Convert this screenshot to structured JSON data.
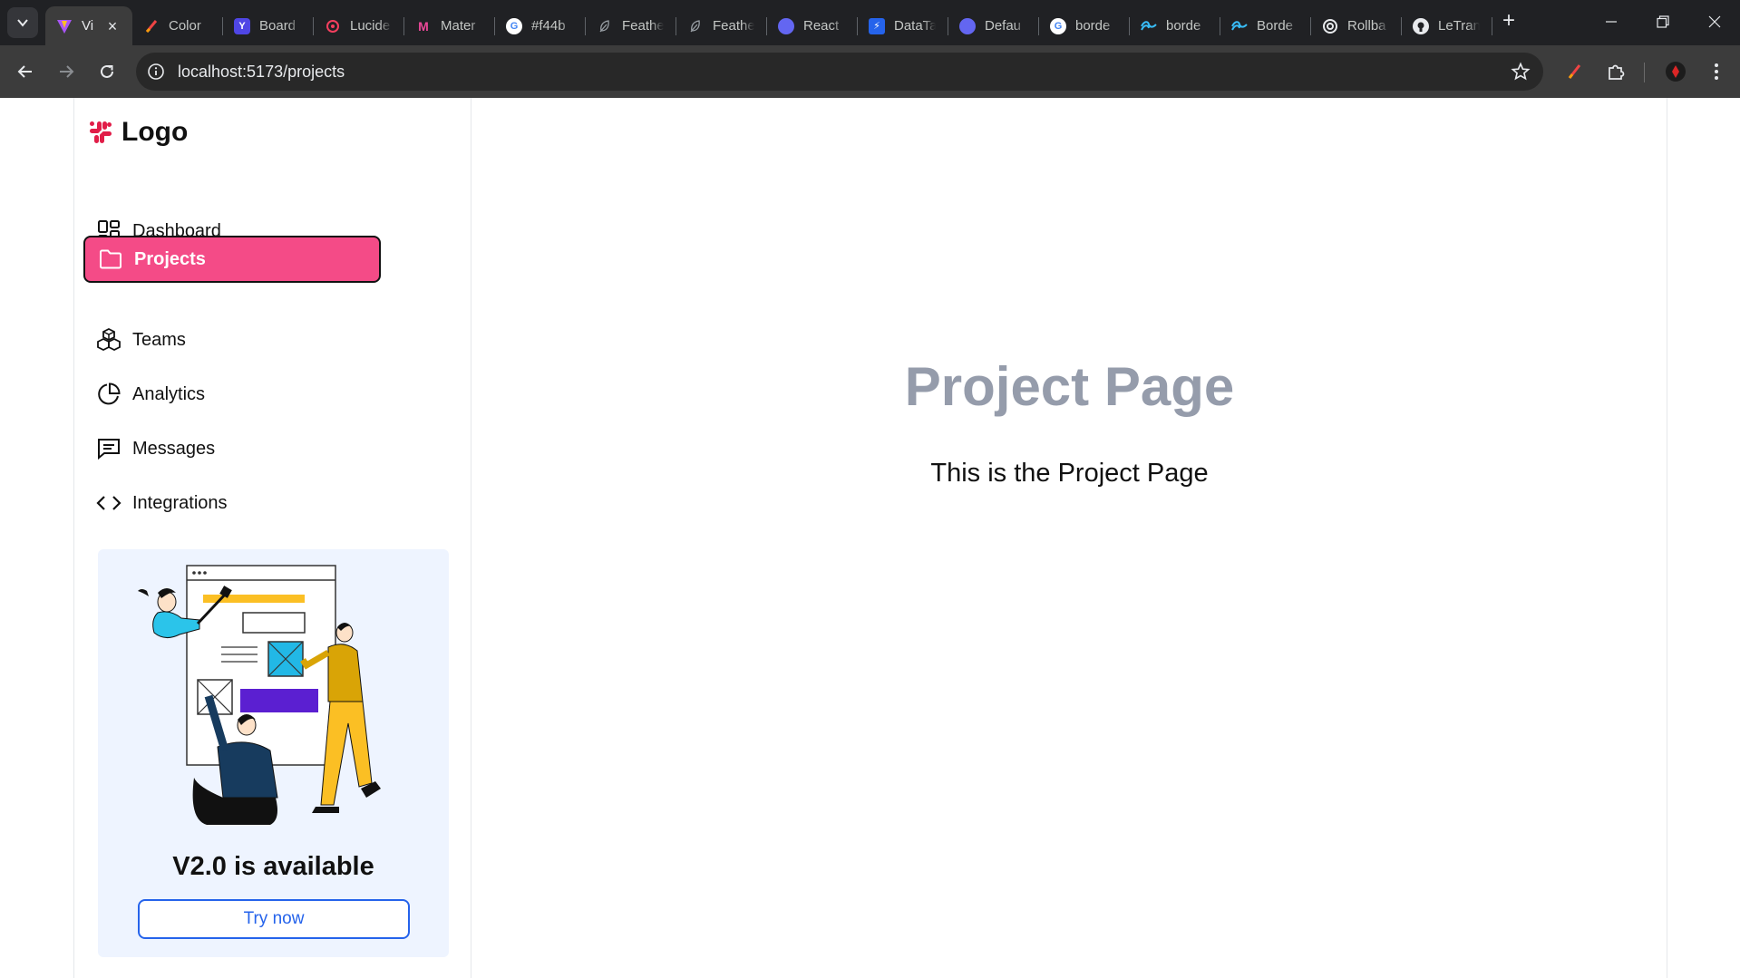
{
  "browser": {
    "tabs": [
      {
        "title": "Vi",
        "active": true,
        "favicon": "vite-icon",
        "color": "#a855f7"
      },
      {
        "title": "Color",
        "favicon": "brush-icon",
        "color": "#ef4444"
      },
      {
        "title": "Board",
        "favicon": "y-icon",
        "color": "#6366f1"
      },
      {
        "title": "Lucide",
        "favicon": "lucide-icon",
        "color": "#f43f5e"
      },
      {
        "title": "Mater",
        "favicon": "material-icon",
        "color": "#ec4899"
      },
      {
        "title": "#f44b",
        "favicon": "google-icon",
        "color": "#ffffff"
      },
      {
        "title": "Feathe",
        "favicon": "feather-icon",
        "color": "#5f6368"
      },
      {
        "title": "Feathe",
        "favicon": "feather-icon",
        "color": "#5f6368"
      },
      {
        "title": "React",
        "favicon": "react-icon",
        "color": "#6366f1"
      },
      {
        "title": "DataTa",
        "favicon": "bolt-icon",
        "color": "#2563eb"
      },
      {
        "title": "Defau",
        "favicon": "circle-icon",
        "color": "#6366f1"
      },
      {
        "title": "borde",
        "favicon": "google-icon",
        "color": "#ffffff"
      },
      {
        "title": "borde",
        "favicon": "tailwind-icon",
        "color": "#38bdf8"
      },
      {
        "title": "Borde",
        "favicon": "tailwind-icon",
        "color": "#38bdf8"
      },
      {
        "title": "Rollba",
        "favicon": "rollbar-icon",
        "color": "#e8eaed"
      },
      {
        "title": "LeTran",
        "favicon": "github-icon",
        "color": "#e8eaed"
      }
    ],
    "url": "localhost:5173/projects"
  },
  "sidebar": {
    "logo_text": "Logo",
    "logo_color": "#e11d48",
    "items": [
      {
        "label": "Dashboard",
        "icon": "dashboard-icon",
        "active": false
      },
      {
        "label": "Projects",
        "icon": "folder-icon",
        "active": true
      },
      {
        "label": "Teams",
        "icon": "boxes-icon",
        "active": false
      },
      {
        "label": "Analytics",
        "icon": "pie-chart-icon",
        "active": false
      },
      {
        "label": "Messages",
        "icon": "message-icon",
        "active": false
      },
      {
        "label": "Integrations",
        "icon": "code-icon",
        "active": false
      }
    ],
    "accent_color": "#f44b87"
  },
  "promo": {
    "title": "V2.0 is available",
    "button": "Try now",
    "button_color": "#2563eb",
    "background": "#eef4ff"
  },
  "main": {
    "heading": "Project Page",
    "text": "This is the Project Page",
    "heading_color": "#959cab"
  }
}
